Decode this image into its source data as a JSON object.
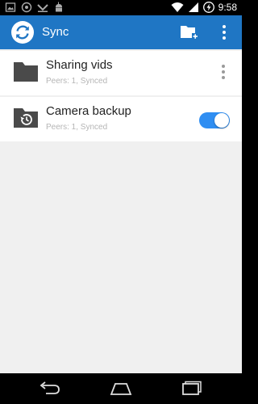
{
  "status_bar": {
    "time": "9:58",
    "icons": [
      "picture-icon",
      "app-circle-icon",
      "download-icon",
      "android-icon",
      "wifi-icon",
      "signal-icon",
      "battery-charging-icon"
    ]
  },
  "app_bar": {
    "title": "Sync",
    "logo": "sync-logo-icon",
    "actions": [
      "add-folder-icon",
      "overflow-menu-icon"
    ]
  },
  "folders": [
    {
      "name": "Sharing vids",
      "status": "Peers: 1, Synced",
      "icon": "folder-icon",
      "control": "overflow-menu"
    },
    {
      "name": "Camera backup",
      "status": "Peers: 1, Synced",
      "icon": "backup-folder-icon",
      "control": "toggle",
      "toggle_on": true
    }
  ],
  "nav_bar": {
    "buttons": [
      "back-icon",
      "home-icon",
      "recent-apps-icon"
    ]
  },
  "colors": {
    "app_bar": "#1f76c4",
    "toggle_on": "#2f8ef2",
    "background": "#f0f0f0",
    "folder_icon": "#4a4a4a"
  }
}
